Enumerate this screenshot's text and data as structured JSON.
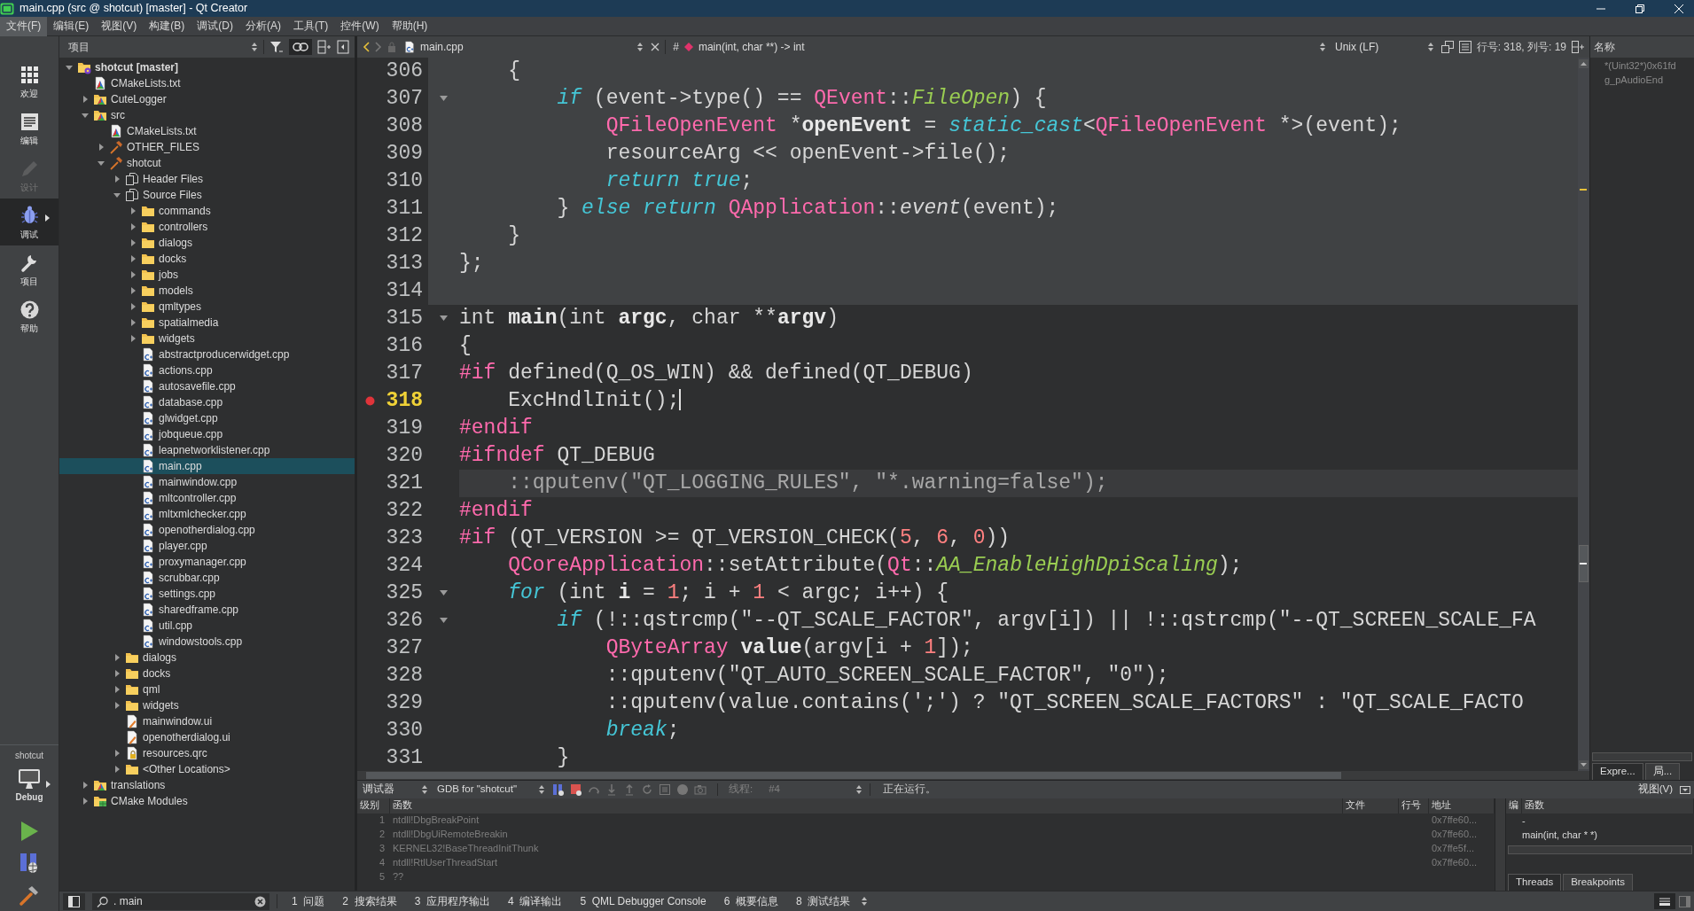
{
  "window": {
    "title": "main.cpp (src @ shotcut) [master] - Qt Creator"
  },
  "menu": [
    {
      "label": "文件(F)",
      "selected": true
    },
    {
      "label": "编辑(E)",
      "selected": false
    },
    {
      "label": "视图(V)",
      "selected": false
    },
    {
      "label": "构建(B)",
      "selected": false
    },
    {
      "label": "调试(D)",
      "selected": false
    },
    {
      "label": "分析(A)",
      "selected": false
    },
    {
      "label": "工具(T)",
      "selected": false
    },
    {
      "label": "控件(W)",
      "selected": false
    },
    {
      "label": "帮助(H)",
      "selected": false
    }
  ],
  "modes": [
    {
      "kind": "welcome",
      "label": "欢迎",
      "selected": false,
      "disabled": false
    },
    {
      "kind": "edit",
      "label": "编辑",
      "selected": false,
      "disabled": false
    },
    {
      "kind": "design",
      "label": "设计",
      "selected": false,
      "disabled": true
    },
    {
      "kind": "debug",
      "label": "调试",
      "selected": true,
      "disabled": false
    },
    {
      "kind": "projects",
      "label": "项目",
      "selected": false,
      "disabled": false
    },
    {
      "kind": "help",
      "label": "帮助",
      "selected": false,
      "disabled": false
    }
  ],
  "build_target": {
    "project": "shotcut",
    "config": "Debug"
  },
  "project_panel": {
    "title": "项目",
    "tree": [
      {
        "label": "shotcut [master]",
        "kind": "project",
        "expanded": true,
        "selected": false,
        "children": [
          {
            "label": "CMakeLists.txt",
            "kind": "cmake",
            "selected": false
          },
          {
            "label": "CuteLogger",
            "kind": "cmake-folder",
            "expanded": false,
            "selected": false
          },
          {
            "label": "src",
            "kind": "cmake-folder",
            "expanded": true,
            "selected": false,
            "children": [
              {
                "label": "CMakeLists.txt",
                "kind": "cmake",
                "selected": false
              },
              {
                "label": "OTHER_FILES",
                "kind": "target",
                "expanded": false,
                "selected": false
              },
              {
                "label": "shotcut",
                "kind": "target",
                "expanded": true,
                "selected": false,
                "children": [
                  {
                    "label": "Header Files",
                    "kind": "group",
                    "expanded": false,
                    "selected": false
                  },
                  {
                    "label": "Source Files",
                    "kind": "group",
                    "expanded": true,
                    "selected": false,
                    "children": [
                      {
                        "label": "commands",
                        "kind": "folder",
                        "expanded": false,
                        "selected": false
                      },
                      {
                        "label": "controllers",
                        "kind": "folder",
                        "expanded": false,
                        "selected": false
                      },
                      {
                        "label": "dialogs",
                        "kind": "folder",
                        "expanded": false,
                        "selected": false
                      },
                      {
                        "label": "docks",
                        "kind": "folder",
                        "expanded": false,
                        "selected": false
                      },
                      {
                        "label": "jobs",
                        "kind": "folder",
                        "expanded": false,
                        "selected": false
                      },
                      {
                        "label": "models",
                        "kind": "folder",
                        "expanded": false,
                        "selected": false
                      },
                      {
                        "label": "qmltypes",
                        "kind": "folder",
                        "expanded": false,
                        "selected": false
                      },
                      {
                        "label": "spatialmedia",
                        "kind": "folder",
                        "expanded": false,
                        "selected": false
                      },
                      {
                        "label": "widgets",
                        "kind": "folder",
                        "expanded": false,
                        "selected": false
                      },
                      {
                        "label": "abstractproducerwidget.cpp",
                        "kind": "cpp",
                        "selected": false
                      },
                      {
                        "label": "actions.cpp",
                        "kind": "cpp",
                        "selected": false
                      },
                      {
                        "label": "autosavefile.cpp",
                        "kind": "cpp",
                        "selected": false
                      },
                      {
                        "label": "database.cpp",
                        "kind": "cpp",
                        "selected": false
                      },
                      {
                        "label": "glwidget.cpp",
                        "kind": "cpp",
                        "selected": false
                      },
                      {
                        "label": "jobqueue.cpp",
                        "kind": "cpp",
                        "selected": false
                      },
                      {
                        "label": "leapnetworklistener.cpp",
                        "kind": "cpp",
                        "selected": false
                      },
                      {
                        "label": "main.cpp",
                        "kind": "cpp",
                        "selected": true
                      },
                      {
                        "label": "mainwindow.cpp",
                        "kind": "cpp",
                        "selected": false
                      },
                      {
                        "label": "mltcontroller.cpp",
                        "kind": "cpp",
                        "selected": false
                      },
                      {
                        "label": "mltxmlchecker.cpp",
                        "kind": "cpp",
                        "selected": false
                      },
                      {
                        "label": "openotherdialog.cpp",
                        "kind": "cpp",
                        "selected": false
                      },
                      {
                        "label": "player.cpp",
                        "kind": "cpp",
                        "selected": false
                      },
                      {
                        "label": "proxymanager.cpp",
                        "kind": "cpp",
                        "selected": false
                      },
                      {
                        "label": "scrubbar.cpp",
                        "kind": "cpp",
                        "selected": false
                      },
                      {
                        "label": "settings.cpp",
                        "kind": "cpp",
                        "selected": false
                      },
                      {
                        "label": "sharedframe.cpp",
                        "kind": "cpp",
                        "selected": false
                      },
                      {
                        "label": "util.cpp",
                        "kind": "cpp",
                        "selected": false
                      },
                      {
                        "label": "windowstools.cpp",
                        "kind": "cpp",
                        "selected": false
                      }
                    ]
                  },
                  {
                    "label": "dialogs",
                    "kind": "folder",
                    "expanded": false,
                    "selected": false
                  },
                  {
                    "label": "docks",
                    "kind": "folder",
                    "expanded": false,
                    "selected": false
                  },
                  {
                    "label": "qml",
                    "kind": "folder",
                    "expanded": false,
                    "selected": false
                  },
                  {
                    "label": "widgets",
                    "kind": "folder",
                    "expanded": false,
                    "selected": false
                  },
                  {
                    "label": "mainwindow.ui",
                    "kind": "ui",
                    "selected": false
                  },
                  {
                    "label": "openotherdialog.ui",
                    "kind": "ui",
                    "selected": false
                  },
                  {
                    "label": "resources.qrc",
                    "kind": "qrc",
                    "expanded": false,
                    "selected": false
                  },
                  {
                    "label": "<Other Locations>",
                    "kind": "folder",
                    "expanded": false,
                    "selected": false
                  }
                ]
              }
            ]
          },
          {
            "label": "translations",
            "kind": "cmake-folder",
            "expanded": false,
            "selected": false
          },
          {
            "label": "CMake Modules",
            "kind": "modules",
            "expanded": false,
            "selected": false
          }
        ]
      }
    ]
  },
  "editor": {
    "file": "main.cpp",
    "symbol_marker": "#",
    "symbol": "main(int, char **) -> int",
    "line_ending": "Unix (LF)",
    "position": "行号: 318, 列号: 19",
    "lines": [
      {
        "number": "306",
        "kind": "block",
        "breakpoint": false,
        "current": false,
        "foldable": false,
        "tokens": [
          {
            "text": "    {",
            "kind": "plain"
          }
        ]
      },
      {
        "number": "307",
        "kind": "block",
        "breakpoint": false,
        "current": false,
        "foldable": true,
        "tokens": [
          {
            "text": "        if",
            "kind": "keyword"
          },
          {
            "text": " (event->type() == ",
            "kind": "plain"
          },
          {
            "text": "QEvent",
            "kind": "type"
          },
          {
            "text": "::",
            "kind": "plain"
          },
          {
            "text": "FileOpen",
            "kind": "enum"
          },
          {
            "text": ") {",
            "kind": "plain"
          }
        ]
      },
      {
        "number": "308",
        "kind": "block",
        "breakpoint": false,
        "current": false,
        "foldable": false,
        "tokens": [
          {
            "text": "            QFileOpenEvent",
            "kind": "type"
          },
          {
            "text": " *",
            "kind": "plain"
          },
          {
            "text": "openEvent",
            "kind": "declaration"
          },
          {
            "text": " = ",
            "kind": "plain"
          },
          {
            "text": "static_cast",
            "kind": "keyword"
          },
          {
            "text": "<",
            "kind": "plain"
          },
          {
            "text": "QFileOpenEvent",
            "kind": "type"
          },
          {
            "text": " *>(event);",
            "kind": "plain"
          }
        ]
      },
      {
        "number": "309",
        "kind": "block",
        "breakpoint": false,
        "current": false,
        "foldable": false,
        "tokens": [
          {
            "text": "            resourceArg << openEvent->file();",
            "kind": "plain"
          }
        ]
      },
      {
        "number": "310",
        "kind": "block",
        "breakpoint": false,
        "current": false,
        "foldable": false,
        "tokens": [
          {
            "text": "            return true",
            "kind": "keyword"
          },
          {
            "text": ";",
            "kind": "plain"
          }
        ]
      },
      {
        "number": "311",
        "kind": "block",
        "breakpoint": false,
        "current": false,
        "foldable": false,
        "tokens": [
          {
            "text": "        } ",
            "kind": "plain"
          },
          {
            "text": "else return",
            "kind": "keyword"
          },
          {
            "text": " QApplication",
            "kind": "type"
          },
          {
            "text": "::",
            "kind": "plain"
          },
          {
            "text": "event",
            "kind": "italic"
          },
          {
            "text": "(event);",
            "kind": "plain"
          }
        ]
      },
      {
        "number": "312",
        "kind": "block",
        "breakpoint": false,
        "current": false,
        "foldable": false,
        "tokens": [
          {
            "text": "    }",
            "kind": "plain"
          }
        ]
      },
      {
        "number": "313",
        "kind": "block",
        "breakpoint": false,
        "current": false,
        "foldable": false,
        "tokens": [
          {
            "text": "};",
            "kind": "plain"
          }
        ]
      },
      {
        "number": "314",
        "kind": "block",
        "breakpoint": false,
        "current": false,
        "foldable": false
      },
      {
        "number": "315",
        "kind": "plain",
        "breakpoint": false,
        "current": false,
        "foldable": true,
        "tokens": [
          {
            "text": "int ",
            "kind": "plain"
          },
          {
            "text": "main",
            "kind": "declaration"
          },
          {
            "text": "(int ",
            "kind": "plain"
          },
          {
            "text": "argc",
            "kind": "declaration"
          },
          {
            "text": ", char **",
            "kind": "plain"
          },
          {
            "text": "argv",
            "kind": "declaration"
          },
          {
            "text": ")",
            "kind": "plain"
          }
        ]
      },
      {
        "number": "316",
        "kind": "plain",
        "breakpoint": false,
        "current": false,
        "foldable": false,
        "tokens": [
          {
            "text": "{",
            "kind": "plain"
          }
        ]
      },
      {
        "number": "317",
        "kind": "plain",
        "breakpoint": false,
        "current": false,
        "foldable": false,
        "tokens": [
          {
            "text": "#if",
            "kind": "preprocessor"
          },
          {
            "text": " defined(Q_OS_WIN) && defined(QT_DEBUG)",
            "kind": "plain"
          }
        ]
      },
      {
        "number": "318",
        "kind": "plain",
        "breakpoint": true,
        "current": true,
        "foldable": false,
        "tokens": [
          {
            "text": "    ExcHndlInit();",
            "kind": "plain"
          }
        ]
      },
      {
        "number": "319",
        "kind": "plain",
        "breakpoint": false,
        "current": false,
        "foldable": false,
        "tokens": [
          {
            "text": "#endif",
            "kind": "preprocessor"
          }
        ]
      },
      {
        "number": "320",
        "kind": "plain",
        "breakpoint": false,
        "current": false,
        "foldable": false,
        "tokens": [
          {
            "text": "#ifndef",
            "kind": "preprocessor"
          },
          {
            "text": " QT_DEBUG",
            "kind": "plain"
          }
        ]
      },
      {
        "number": "321",
        "kind": "inactive",
        "breakpoint": false,
        "current": false,
        "foldable": false,
        "tokens": [
          {
            "text": "    ::qputenv(\"QT_LOGGING_RULES\", \"*.warning=false\");",
            "kind": "plain"
          }
        ]
      },
      {
        "number": "322",
        "kind": "plain",
        "breakpoint": false,
        "current": false,
        "foldable": false,
        "tokens": [
          {
            "text": "#endif",
            "kind": "preprocessor"
          }
        ]
      },
      {
        "number": "323",
        "kind": "plain",
        "breakpoint": false,
        "current": false,
        "foldable": false,
        "tokens": [
          {
            "text": "#if",
            "kind": "preprocessor"
          },
          {
            "text": " (QT_VERSION >= QT_VERSION_CHECK(",
            "kind": "plain"
          },
          {
            "text": "5",
            "kind": "number"
          },
          {
            "text": ", ",
            "kind": "plain"
          },
          {
            "text": "6",
            "kind": "number"
          },
          {
            "text": ", ",
            "kind": "plain"
          },
          {
            "text": "0",
            "kind": "number"
          },
          {
            "text": "))",
            "kind": "plain"
          }
        ]
      },
      {
        "number": "324",
        "kind": "plain",
        "breakpoint": false,
        "current": false,
        "foldable": false,
        "tokens": [
          {
            "text": "    QCoreApplication",
            "kind": "type"
          },
          {
            "text": "::setAttribute(",
            "kind": "plain"
          },
          {
            "text": "Qt",
            "kind": "type"
          },
          {
            "text": "::",
            "kind": "plain"
          },
          {
            "text": "AA_EnableHighDpiScaling",
            "kind": "enum"
          },
          {
            "text": ");",
            "kind": "plain"
          }
        ]
      },
      {
        "number": "325",
        "kind": "plain",
        "breakpoint": false,
        "current": false,
        "foldable": true,
        "tokens": [
          {
            "text": "    for",
            "kind": "keyword"
          },
          {
            "text": " (int ",
            "kind": "plain"
          },
          {
            "text": "i",
            "kind": "declaration"
          },
          {
            "text": " = ",
            "kind": "plain"
          },
          {
            "text": "1",
            "kind": "number"
          },
          {
            "text": "; i + ",
            "kind": "plain"
          },
          {
            "text": "1",
            "kind": "number"
          },
          {
            "text": " < argc; i++) {",
            "kind": "plain"
          }
        ]
      },
      {
        "number": "326",
        "kind": "plain",
        "breakpoint": false,
        "current": false,
        "foldable": true,
        "tokens": [
          {
            "text": "        if",
            "kind": "keyword"
          },
          {
            "text": " (!::qstrcmp(\"--QT_SCALE_FACTOR\", argv[i]) || !::qstrcmp(\"--QT_SCREEN_SCALE_FA",
            "kind": "plain"
          }
        ]
      },
      {
        "number": "327",
        "kind": "plain",
        "breakpoint": false,
        "current": false,
        "foldable": false,
        "tokens": [
          {
            "text": "            QByteArray",
            "kind": "type"
          },
          {
            "text": " value",
            "kind": "declaration"
          },
          {
            "text": "(argv[i + ",
            "kind": "plain"
          },
          {
            "text": "1",
            "kind": "number"
          },
          {
            "text": "]);",
            "kind": "plain"
          }
        ]
      },
      {
        "number": "328",
        "kind": "plain",
        "breakpoint": false,
        "current": false,
        "foldable": false,
        "tokens": [
          {
            "text": "            ::qputenv(\"QT_AUTO_SCREEN_SCALE_FACTOR\", \"0\");",
            "kind": "plain"
          }
        ]
      },
      {
        "number": "329",
        "kind": "plain",
        "breakpoint": false,
        "current": false,
        "foldable": false,
        "tokens": [
          {
            "text": "            ::qputenv(value.contains(';') ? \"QT_SCREEN_SCALE_FACTORS\" : \"QT_SCALE_FACTO",
            "kind": "plain"
          }
        ]
      },
      {
        "number": "330",
        "kind": "plain",
        "breakpoint": false,
        "current": false,
        "foldable": false,
        "tokens": [
          {
            "text": "            break",
            "kind": "keyword"
          },
          {
            "text": ";",
            "kind": "plain"
          }
        ]
      },
      {
        "number": "331",
        "kind": "plain",
        "breakpoint": false,
        "current": false,
        "foldable": false,
        "tokens": [
          {
            "text": "        }",
            "kind": "plain"
          }
        ]
      }
    ]
  },
  "watch_panel": {
    "column": "名称",
    "rows": [
      "*(Uint32*)0x61fd",
      "g_pAudioEnd"
    ],
    "tabs": [
      {
        "label": "Expre...",
        "selected": true
      },
      {
        "label": "局...",
        "selected": false
      }
    ]
  },
  "debugger": {
    "label": "调试器",
    "engine": "GDB for \"shotcut\"",
    "thread_label": "线程:",
    "thread": "#4",
    "status": "正在运行。",
    "view_menu": "视图(V)",
    "stack": {
      "columns": [
        "级别",
        "函数",
        "文件",
        "行号",
        "地址"
      ],
      "rows": [
        {
          "level": "1",
          "function": "ntdll!DbgBreakPoint",
          "address": "0x7ffe60..."
        },
        {
          "level": "2",
          "function": "ntdll!DbgUiRemoteBreakin",
          "address": "0x7ffe60..."
        },
        {
          "level": "3",
          "function": "KERNEL32!BaseThreadInitThunk",
          "address": "0x7ffe5f..."
        },
        {
          "level": "4",
          "function": "ntdll!RtlUserThreadStart",
          "address": "0x7ffe60..."
        },
        {
          "level": "5",
          "function": "??"
        }
      ]
    },
    "threads": {
      "columns": [
        "编",
        "函数"
      ],
      "rows": [
        "-",
        "main(int, char * *)"
      ],
      "tabs": [
        {
          "label": "Threads",
          "selected": true
        },
        {
          "label": "Breakpoints",
          "selected": false
        }
      ]
    }
  },
  "status_bar": {
    "search": ". main",
    "panes": [
      {
        "number": "1",
        "label": "问题"
      },
      {
        "number": "2",
        "label": "搜索结果"
      },
      {
        "number": "3",
        "label": "应用程序输出"
      },
      {
        "number": "4",
        "label": "编译输出"
      },
      {
        "number": "5",
        "label": "QML Debugger Console"
      },
      {
        "number": "6",
        "label": "概要信息"
      },
      {
        "number": "8",
        "label": "测试结果"
      }
    ]
  }
}
